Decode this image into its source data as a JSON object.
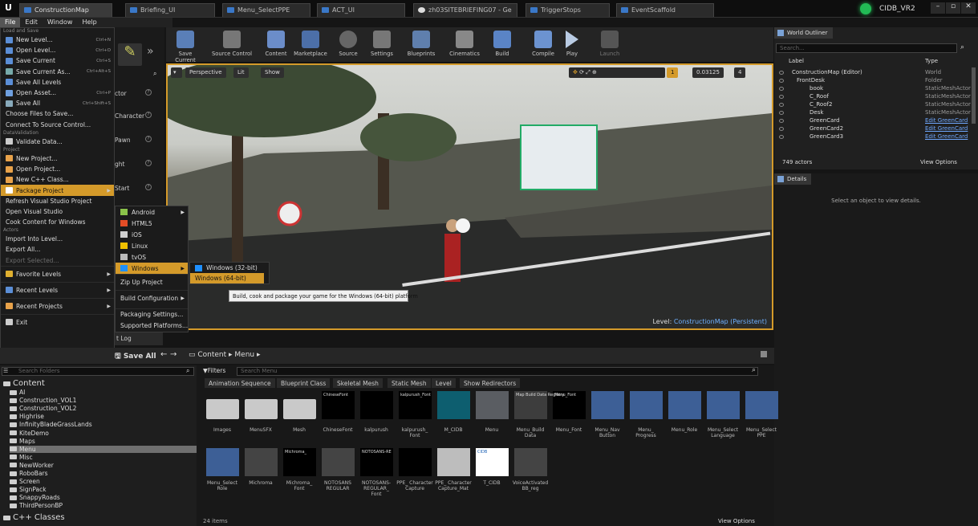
{
  "tabs": [
    "ConstructionMap",
    "Briefing_UI",
    "Menu_SelectPPE",
    "ACT_UI",
    "zh03SITEBRIEFING07 - Ge",
    "TriggerStops",
    "EventScaffold"
  ],
  "window": {
    "user": "CIDB_VR2"
  },
  "menubar": [
    "File",
    "Edit",
    "Window",
    "Help"
  ],
  "file_menu": {
    "section_load": "Load and Save",
    "load_items": [
      {
        "label": "New Level...",
        "shortcut": "Ctrl+N"
      },
      {
        "label": "Open Level...",
        "shortcut": "Ctrl+O"
      },
      {
        "label": "Save Current",
        "shortcut": "Ctrl+S"
      },
      {
        "label": "Save Current As...",
        "shortcut": "Ctrl+Alt+S"
      },
      {
        "label": "Save All Levels",
        "shortcut": ""
      },
      {
        "label": "Open Asset...",
        "shortcut": "Ctrl+P"
      },
      {
        "label": "Save All",
        "shortcut": "Ctrl+Shift+S"
      },
      {
        "label": "Choose Files to Save...",
        "shortcut": ""
      },
      {
        "label": "Connect To Source Control...",
        "shortcut": ""
      }
    ],
    "section_validation": "DataValidation",
    "validate": "Validate Data...",
    "section_project": "Project",
    "project_items": [
      "New Project...",
      "Open Project...",
      "New C++ Class...",
      "Package Project",
      "Refresh Visual Studio Project",
      "Open Visual Studio",
      "Cook Content for Windows"
    ],
    "section_actors": "Actors",
    "actor_items": [
      "Import Into Level...",
      "Export All...",
      "Export Selected..."
    ],
    "bottom_items": [
      "Favorite Levels",
      "Recent Levels",
      "Recent Projects",
      "Exit"
    ]
  },
  "package_submenu": {
    "platforms": [
      "Android",
      "HTML5",
      "iOS",
      "Linux",
      "tvOS",
      "Windows"
    ],
    "extras": [
      "Zip Up Project",
      "Build Configuration",
      "Packaging Settings...",
      "Supported Platforms..."
    ]
  },
  "windows_submenu": [
    "Windows (32-bit)",
    "Windows (64-bit)"
  ],
  "tooltip": "Build, cook and package your game for the Windows (64-bit) platform",
  "modes": [
    "ctor",
    "Character",
    "Pawn",
    "ght",
    "Start"
  ],
  "toolbar": [
    "Save Current",
    "Source Control",
    "Content",
    "Marketplace",
    "Source",
    "Settings",
    "Blueprints",
    "Cinematics",
    "Build",
    "Compile",
    "Play",
    "Launch"
  ],
  "viewport": {
    "perspective": "Perspective",
    "lit": "Lit",
    "show": "Show",
    "snap_value": "0.03125",
    "grid_value": "1",
    "camera_value": "4",
    "level_label": "Level:",
    "level_name": "ConstructionMap (Persistent)"
  },
  "outliner": {
    "tab": "World Outliner",
    "search_placeholder": "Search...",
    "col_label": "Label",
    "col_type": "Type",
    "rows": [
      {
        "label": "ConstructionMap (Editor)",
        "type": "World"
      },
      {
        "label": "FrontDesk",
        "type": "Folder"
      },
      {
        "label": "book",
        "type": "StaticMeshActor"
      },
      {
        "label": "C_Roof",
        "type": "StaticMeshActor"
      },
      {
        "label": "C_Roof2",
        "type": "StaticMeshActor"
      },
      {
        "label": "Desk",
        "type": "StaticMeshActor"
      },
      {
        "label": "GreenCard",
        "type": "Edit GreenCard"
      },
      {
        "label": "GreenCard2",
        "type": "Edit GreenCard"
      },
      {
        "label": "GreenCard3",
        "type": "Edit GreenCard"
      }
    ],
    "count": "749 actors",
    "view_options": "View Options"
  },
  "details": {
    "tab": "Details",
    "empty": "Select an object to view details."
  },
  "content_browser": {
    "save_all": "Save All",
    "path": [
      "Content",
      "Menu"
    ],
    "log_tab": "t Log",
    "search_folders": "Search Folders",
    "filters": "Filters",
    "search_assets": "Search Menu",
    "filter_tabs": [
      "Animation Sequence",
      "Blueprint Class",
      "Skeletal Mesh",
      "Static Mesh",
      "Level",
      "Show Redirectors"
    ],
    "root": "Content",
    "folders": [
      "AI",
      "Construction_VOL1",
      "Construction_VOL2",
      "Highrise",
      "InfinityBladeGrassLands",
      "KiteDemo",
      "Maps",
      "Menu",
      "Misc",
      "NewWorker",
      "RoboBars",
      "Screen",
      "SignPack",
      "SnappyRoads",
      "ThirdPersonBP"
    ],
    "cpp": "C++ Classes",
    "assets": [
      "Images",
      "MenuSFX",
      "Mesh",
      "ChineseFont",
      "kalpurush",
      "kalpurush_ Font",
      "M_CIDB",
      "Menu",
      "Menu_Build Data",
      "Menu_Font",
      "Menu_Nav Button",
      "Menu_ Progress",
      "Menu_Role",
      "Menu_Select Language",
      "Menu_Select PPE",
      "Menu_Select Role",
      "Michroma",
      "Michroma_ Font",
      "NOTOSANS REGULAR",
      "NOTOSANS- REGULAR_ Font",
      "PPE_ Character Capture",
      "PPE_ Character Capture_Mat",
      "T_CIDB",
      "VoiceActivated BB_reg"
    ],
    "thumb_texts": [
      "ChineseFont",
      "kalpurush_Font",
      "Map Build Data Registry",
      "Menu_Font",
      "Michroma_",
      "NOTOSANS-RE",
      "CIDB"
    ],
    "items_count": "24 items",
    "view_options": "View Options"
  },
  "colors": {
    "accent": "#d49a2a",
    "link": "#6fa8ff",
    "panel": "#1b1b1b"
  }
}
